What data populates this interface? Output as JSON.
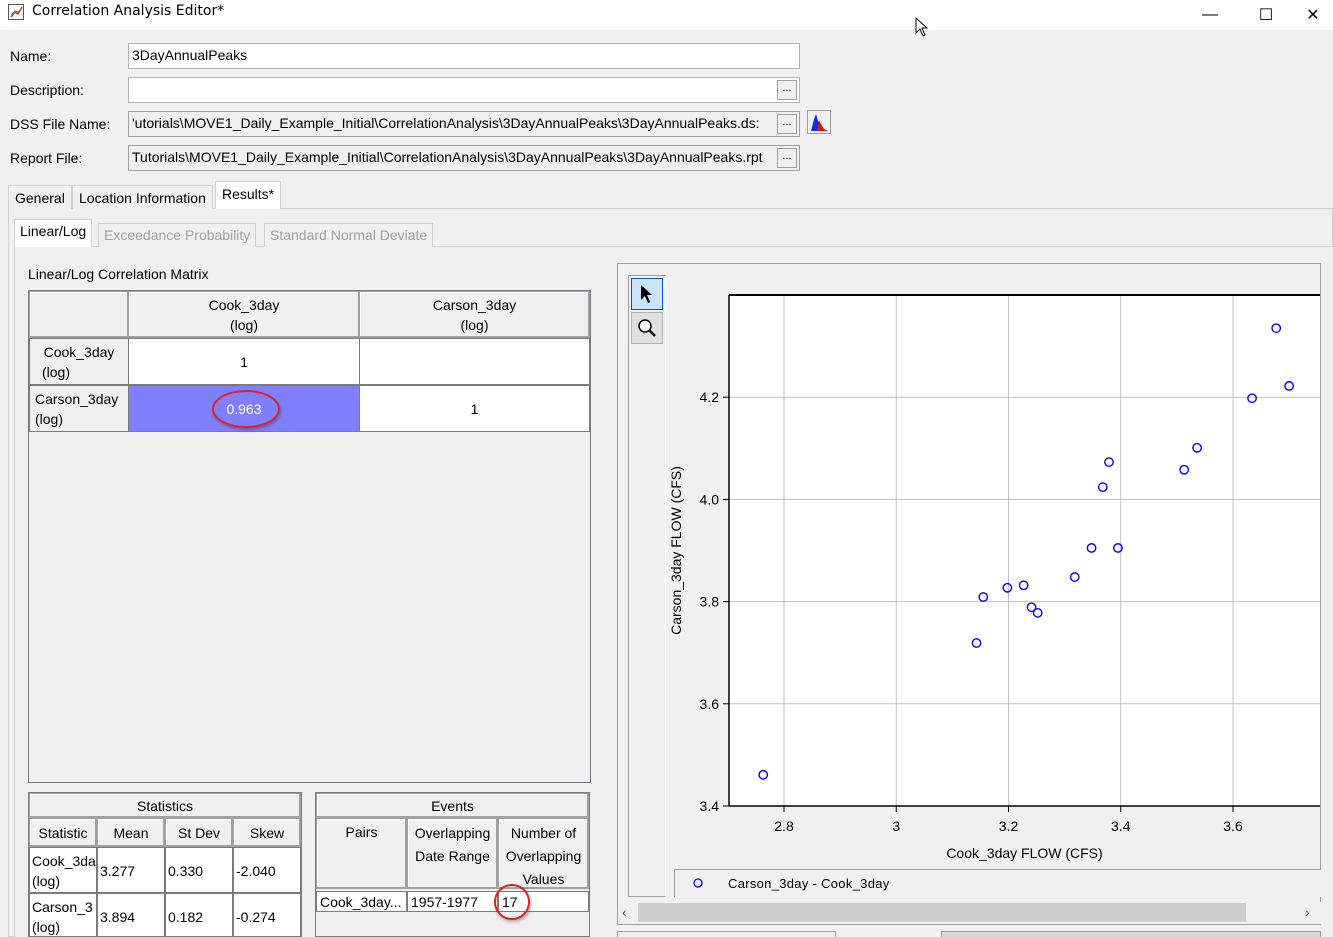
{
  "window": {
    "title": "Correlation Analysis Editor*",
    "icon": "chart-app-icon",
    "controls": {
      "minimize": "—",
      "maximize": "☐",
      "close": "✕"
    }
  },
  "form": {
    "name_label": "Name:",
    "name_value": "3DayAnnualPeaks",
    "description_label": "Description:",
    "description_value": "",
    "dss_label": "DSS File Name:",
    "dss_value": "'utorials\\MOVE1_Daily_Example_Initial\\CorrelationAnalysis\\3DayAnnualPeaks\\3DayAnnualPeaks.ds:",
    "report_label": "Report File:",
    "report_value": "Tutorials\\MOVE1_Daily_Example_Initial\\CorrelationAnalysis\\3DayAnnualPeaks\\3DayAnnualPeaks.rpt",
    "browse_label": "..."
  },
  "tabs": [
    {
      "label": "General",
      "active": false
    },
    {
      "label": "Location Information",
      "active": false
    },
    {
      "label": "Results*",
      "active": true
    }
  ],
  "subtabs": [
    {
      "label": "Linear/Log",
      "active": true,
      "enabled": true
    },
    {
      "label": "Exceedance Probability",
      "active": false,
      "enabled": false
    },
    {
      "label": "Standard Normal Deviate",
      "active": false,
      "enabled": false
    }
  ],
  "matrix": {
    "title": "Linear/Log Correlation Matrix",
    "col_headers": [
      {
        "line1": "Cook_3day",
        "line2": "(log)"
      },
      {
        "line1": "Carson_3day",
        "line2": "(log)"
      }
    ],
    "rows": [
      {
        "line1": "Cook_3day",
        "line2": "(log)",
        "values": [
          "1",
          ""
        ]
      },
      {
        "line1": "Carson_3day",
        "line2": "(log)",
        "values": [
          "0.963",
          "1"
        ]
      }
    ],
    "highlight_color": "#8080ff"
  },
  "statistics": {
    "title": "Statistics",
    "headers": [
      "Statistic",
      "Mean",
      "St Dev",
      "Skew"
    ],
    "rows": [
      {
        "name1": "Cook_3da",
        "name2": "(log)",
        "mean": "3.277",
        "stdev": "0.330",
        "skew": "-2.040"
      },
      {
        "name1": "Carson_3",
        "name2": "(log)",
        "mean": "3.894",
        "stdev": "0.182",
        "skew": "-0.274"
      }
    ]
  },
  "events": {
    "title": "Events",
    "headers": [
      {
        "l1": "Pairs",
        "l2": "",
        "l3": ""
      },
      {
        "l1": "Overlapping",
        "l2": "Date Range",
        "l3": ""
      },
      {
        "l1": "Number of",
        "l2": "Overlapping",
        "l3": "Values"
      }
    ],
    "rows": [
      {
        "pair": "Cook_3day...",
        "range": "1957-1977",
        "count": "17"
      }
    ]
  },
  "toolbar": {
    "select_tool": "pointer-icon",
    "zoom_tool": "magnifier-icon"
  },
  "legend": {
    "label": "Carson_3day - Cook_3day"
  },
  "chart_data": {
    "type": "scatter",
    "title": "",
    "xlabel": "Cook_3day FLOW (CFS)",
    "ylabel": "Carson_3day FLOW (CFS)",
    "xlim": [
      2.702,
      3.755
    ],
    "ylim": [
      3.4,
      4.4
    ],
    "xticks": [
      2.8,
      3.0,
      3.2,
      3.4,
      3.6
    ],
    "xtick_labels": [
      "2.8",
      "3",
      "3.2",
      "3.4",
      "3.6"
    ],
    "yticks": [
      3.4,
      3.6,
      3.8,
      4.0,
      4.2
    ],
    "ytick_labels": [
      "3.4",
      "3.6",
      "3.8",
      "4.0",
      "4.2"
    ],
    "grid": true,
    "legend_position": "bottom",
    "marker_color": "#0000ff",
    "series": [
      {
        "name": "Carson_3day - Cook_3day",
        "points": [
          [
            2.763,
            3.461
          ],
          [
            3.143,
            3.719
          ],
          [
            3.155,
            3.809
          ],
          [
            3.198,
            3.827
          ],
          [
            3.227,
            3.832
          ],
          [
            3.241,
            3.789
          ],
          [
            3.252,
            3.778
          ],
          [
            3.318,
            3.848
          ],
          [
            3.348,
            3.905
          ],
          [
            3.395,
            3.905
          ],
          [
            3.368,
            4.024
          ],
          [
            3.379,
            4.073
          ],
          [
            3.513,
            4.058
          ],
          [
            3.536,
            4.101
          ],
          [
            3.634,
            4.198
          ],
          [
            3.7,
            4.222
          ],
          [
            3.677,
            4.335
          ]
        ]
      }
    ]
  }
}
